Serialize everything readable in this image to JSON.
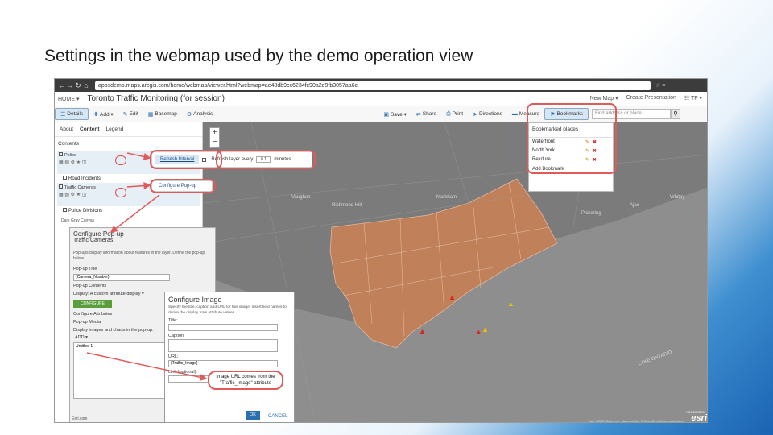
{
  "slide": {
    "title": "Settings in the webmap used by the demo operation view"
  },
  "browser": {
    "url": "appsdemo.maps.arcgis.com/home/webmap/viewer.html?webmap=ae48db9cc6234fc90a2d9fb3057aa6c",
    "nav": [
      "←",
      "→",
      "↻",
      "⌂"
    ],
    "icons": "☆ ≡"
  },
  "app": {
    "home": "HOME ▾",
    "title": "Toronto Traffic Monitoring (for session)",
    "header_right": [
      "New Map ▾",
      "Create Presentation",
      "☷ TF ▾"
    ]
  },
  "toolbar": {
    "left": [
      "Details",
      "Add ▾",
      "Edit",
      "Basemap",
      "Analysis"
    ],
    "right": [
      "Save ▾",
      "Share",
      "Print",
      "Directions",
      "Measure",
      "Bookmarks"
    ],
    "find_placeholder": "Find address or place"
  },
  "left_panel": {
    "tabs": [
      "About",
      "Content",
      "Legend"
    ],
    "contents_label": "Contents",
    "layers": [
      {
        "name": "Police",
        "sublayer": "Road Incidents"
      },
      {
        "name": "Traffic Cameras",
        "sublayer": "Police Divisions"
      }
    ],
    "basemap": "Dark Gray Canvas"
  },
  "refresh_popup": {
    "option": "Refresh Interval",
    "label": "Refresh layer every",
    "value": "0.1",
    "unit": "minutes"
  },
  "configure_popup_option": "Configure Pop-up",
  "bookmarks": {
    "header": "Bookmarked places",
    "items": [
      "Waterfront",
      "North York",
      "Rexdure"
    ],
    "add": "Add Bookmark",
    "edit_icon": "✎",
    "delete_icon": "✖"
  },
  "configure_panel": {
    "title": "Configure Pop-up",
    "subtitle": "Traffic Cameras",
    "desc": "Pop-ups display information about features in the layer. Define the pop-up below.",
    "title_label": "Pop-up Title",
    "title_value": "{Camera_Number}",
    "contents_label": "Pop-up Contents",
    "display_label": "Display:",
    "display_value": "A custom attribute display ▾",
    "configure_button": "CONFIGURE",
    "attributes_label": "Configure Attributes",
    "media_label": "Pop-up Media",
    "media_desc": "Display images and charts in the pop-up:",
    "add_label": "ADD ▾",
    "list_item": "Untitled 1",
    "footer": "Esri.com"
  },
  "image_dialog": {
    "title": "Configure Image",
    "desc": "Specify the title, caption and URL for this image. Insert field names to derive the display from attribute values.",
    "title_label": "Title:",
    "caption_label": "Caption:",
    "url_label": "URL:",
    "url_value": "{Traffic_Image}",
    "link_label": "Link (optional):",
    "ok": "OK",
    "cancel": "CANCEL"
  },
  "callout": {
    "line1": "Image URL comes from the",
    "line2": "\"Traffic_Image\" attribute"
  },
  "map": {
    "labels": [
      "Richmond Hill",
      "Markham",
      "Pickering",
      "Ajax",
      "Whitby",
      "Vaughan"
    ],
    "attribution": "Esri, HERE, DeLorme, MapmyIndia, © OpenStreetMap contributors",
    "powered_by": "POWERED BY",
    "logo": "esri",
    "lake_label": "LAKE ONTARIO"
  },
  "colors": {
    "accent": "#2a6fb0",
    "highlight_ring": "#e05a5a",
    "map_city": "#c0815a",
    "map_background": "#7b7b7b"
  }
}
